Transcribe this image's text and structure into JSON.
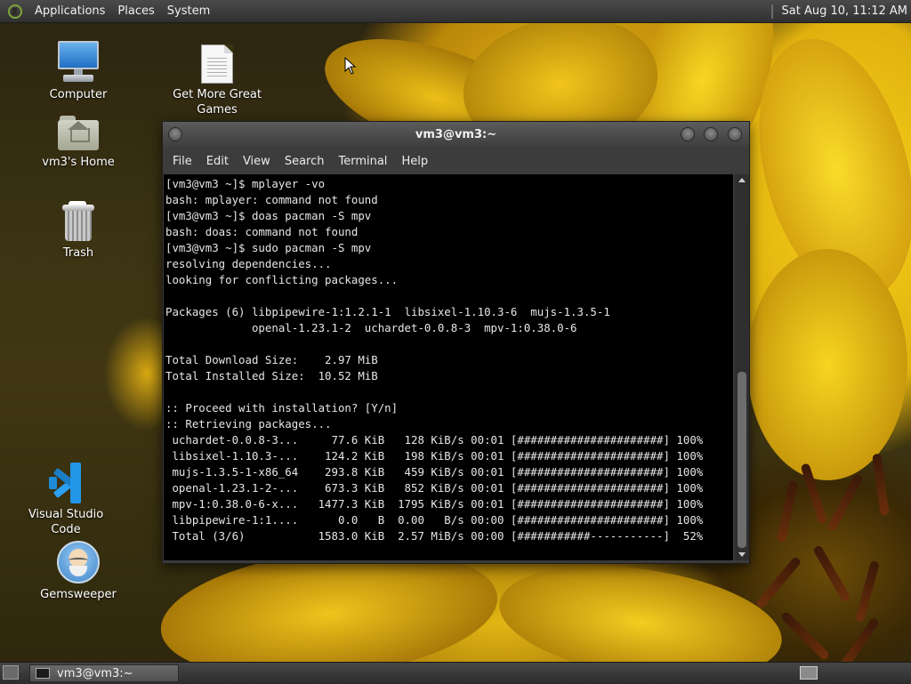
{
  "top_panel": {
    "menus": [
      "Applications",
      "Places",
      "System"
    ],
    "clock": "Sat Aug 10, 11:12 AM"
  },
  "desktop_icons": [
    {
      "label": "Computer",
      "icon": "computer-icon"
    },
    {
      "label": "Get More Great Games",
      "icon": "document-icon"
    },
    {
      "label": "vm3's Home",
      "icon": "home-folder-icon"
    },
    {
      "label": "Trash",
      "icon": "trash-icon"
    },
    {
      "label": "Visual Studio Code",
      "icon": "vscode-icon"
    },
    {
      "label": "Gemsweeper",
      "icon": "gemsweeper-icon"
    }
  ],
  "terminal": {
    "title": "vm3@vm3:~",
    "menus": [
      "File",
      "Edit",
      "View",
      "Search",
      "Terminal",
      "Help"
    ],
    "lines": [
      "[vm3@vm3 ~]$ mplayer -vo",
      "bash: mplayer: command not found",
      "[vm3@vm3 ~]$ doas pacman -S mpv",
      "bash: doas: command not found",
      "[vm3@vm3 ~]$ sudo pacman -S mpv",
      "resolving dependencies...",
      "looking for conflicting packages...",
      "",
      "Packages (6) libpipewire-1:1.2.1-1  libsixel-1.10.3-6  mujs-1.3.5-1",
      "             openal-1.23.1-2  uchardet-0.0.8-3  mpv-1:0.38.0-6",
      "",
      "Total Download Size:    2.97 MiB",
      "Total Installed Size:  10.52 MiB",
      "",
      ":: Proceed with installation? [Y/n]",
      ":: Retrieving packages...",
      " uchardet-0.0.8-3...     77.6 KiB   128 KiB/s 00:01 [######################] 100%",
      " libsixel-1.10.3-...    124.2 KiB   198 KiB/s 00:01 [######################] 100%",
      " mujs-1.3.5-1-x86_64    293.8 KiB   459 KiB/s 00:01 [######################] 100%",
      " openal-1.23.1-2-...    673.3 KiB   852 KiB/s 00:01 [######################] 100%",
      " mpv-1:0.38.0-6-x...   1477.3 KiB  1795 KiB/s 00:01 [######################] 100%",
      " libpipewire-1:1....      0.0   B  0.00   B/s 00:00 [######################] 100%",
      " Total (3/6)           1583.0 KiB  2.57 MiB/s 00:00 [###########-----------]  52%"
    ]
  },
  "taskbar": {
    "window_button": "vm3@vm3:~"
  }
}
